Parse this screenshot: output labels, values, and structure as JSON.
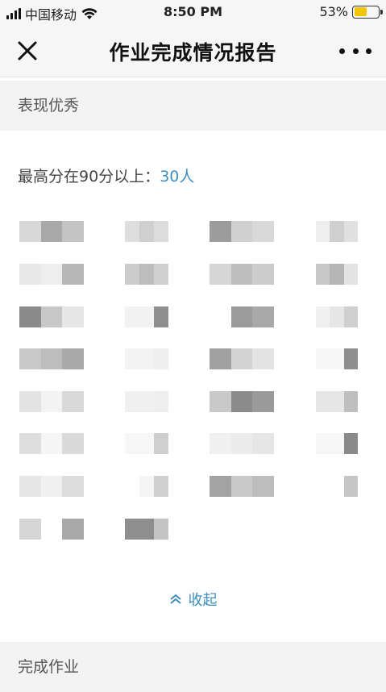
{
  "status_bar": {
    "carrier": "中国移动",
    "time": "8:50 PM",
    "battery_percent": "53%",
    "battery_level": 0.53,
    "battery_color": "#f2c500"
  },
  "nav": {
    "title": "作业完成情况报告",
    "close_icon": "close-icon",
    "more_icon": "more-icon"
  },
  "excellent_section": {
    "header": "表现优秀",
    "stat_label": "最高分在90分以上：",
    "stat_count": "30人",
    "accent_color": "#3d8fbd",
    "students_blurred": true
  },
  "collapse_button": {
    "label": "收起",
    "icon": "chevron-up-icon"
  },
  "completed_section": {
    "header": "完成作业"
  }
}
